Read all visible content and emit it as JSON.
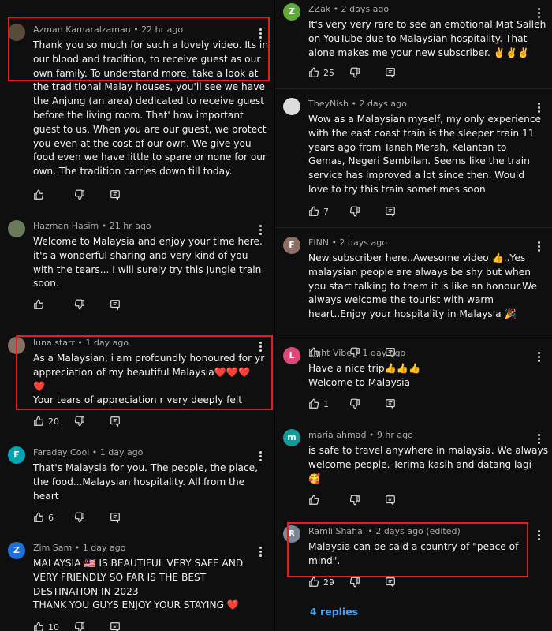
{
  "left_comments": [
    {
      "author": "Azman Kamaralzaman",
      "time": "22 hr ago",
      "avatar_letter": "",
      "avatar_color": "#5a4a3a",
      "lines": [
        "Thank you so much for such a lovely video. Its in",
        "our blood and tradition, to receive guest as our",
        "own family. To understand more, take a look at",
        "the traditional Malay houses, you'll see we have",
        "the Anjung (an area) dedicated to receive guest",
        "before the living room. That' how important",
        "guest to us. When you are our guest, we protect",
        "you even at the cost of our own. We give you",
        "food even we have little to spare or none for our",
        "own. The tradition carries down till today."
      ],
      "likes": ""
    },
    {
      "author": "Hazman Hasim",
      "time": "21 hr ago",
      "avatar_letter": "",
      "avatar_color": "#6b7a5a",
      "lines": [
        "Welcome to Malaysia and enjoy your time here.",
        "it's a wonderful sharing and very kind of you",
        "with the tears...  I will surely try this Jungle train",
        "soon."
      ],
      "likes": ""
    },
    {
      "author": "luna starr",
      "time": "1 day ago",
      "avatar_letter": "",
      "avatar_color": "#8a6f65",
      "lines": [
        "As a Malaysian, i am profoundly honoured for yr",
        "appreciation of my beautiful Malaysia❤️❤️❤️",
        "❤️",
        "Your tears of appreciation r very deeply felt"
      ],
      "likes": "20"
    },
    {
      "author": "Faraday Cool",
      "time": "1 day ago",
      "avatar_letter": "F",
      "avatar_color": "#00a6b4",
      "lines": [
        "That's Malaysia for you. The people, the place,",
        "the food...Malaysian hospitality. All from the",
        "heart"
      ],
      "likes": "6"
    },
    {
      "author": "Zim Sam",
      "time": "1 day ago",
      "avatar_letter": "Z",
      "avatar_color": "#1e6fd9",
      "lines": [
        "MALAYSIA 🇲🇾 IS BEAUTIFUL VERY SAFE AND",
        "VERY FRIENDLY SO FAR IS THE BEST",
        "DESTINATION IN 2023",
        "THANK YOU GUYS ENJOY YOUR STAYING ❤️"
      ],
      "likes": "10"
    }
  ],
  "right_comments": [
    {
      "author": "ZZak",
      "time": "2 days ago",
      "avatar_letter": "Z",
      "avatar_color": "#5fa83a",
      "lines": [
        "It's very very rare to see an emotional Mat Salleh",
        "on YouTube due to Malaysian hospitality. That",
        "alone makes me your new subscriber. ✌️✌️✌️"
      ],
      "likes": "25"
    },
    {
      "author": "TheyNish",
      "time": "2 days ago",
      "avatar_letter": "",
      "avatar_color": "#dcdcdc",
      "lines": [
        "Wow as a Malaysian myself, my only experience",
        "with the east coast train is the sleeper train 11",
        "years ago from Tanah Merah, Kelantan to",
        "Gemas, Negeri Sembilan. Seems like the train",
        "service has improved a lot since then. Would",
        "love to try this train sometimes soon"
      ],
      "likes": "7"
    },
    {
      "author": "FINN",
      "time": "2 days ago",
      "avatar_letter": "F",
      "avatar_color": "#8d6e63",
      "lines": [
        "New subscriber here..Awesome video 👍..Yes",
        "malaysian people are always be shy but when",
        "you start talking to them it is like an honour.We",
        "always welcome the tourist with warm",
        "heart..Enjoy your hospitality in Malaysia 🎉"
      ],
      "likes": ""
    },
    {
      "author": "Light Vibe",
      "time": "1 day ago",
      "avatar_letter": "L",
      "avatar_color": "#e0457b",
      "lines": [
        "Have a nice trip👍👍👍",
        "Welcome to Malaysia"
      ],
      "likes": "1"
    },
    {
      "author": "maria ahmad",
      "time": "9 hr ago",
      "avatar_letter": "m",
      "avatar_color": "#159a9c",
      "lines": [
        "is safe to travel anywhere in malaysia. We always",
        "welcome people. Terima kasih and datang lagi",
        "🥰"
      ],
      "likes": ""
    },
    {
      "author": "Ramli Shafial",
      "time": "2 days ago (edited)",
      "avatar_letter": "R",
      "avatar_color": "#7b8794",
      "lines": [
        "Malaysia can be said a country of \"peace of",
        "mind\"."
      ],
      "likes": "29"
    }
  ],
  "replies_label": "4 replies",
  "colors": {
    "background": "#0f0f0f",
    "highlight_box": "#e41e1e",
    "link_blue": "#3ea6ff"
  }
}
